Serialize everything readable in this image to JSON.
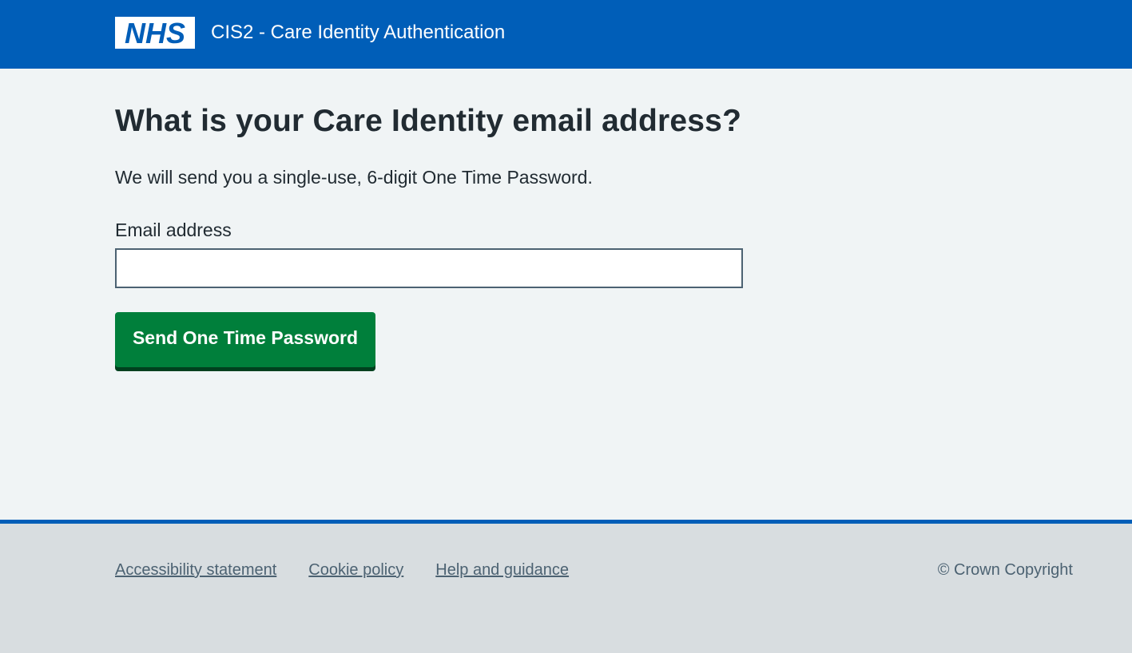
{
  "header": {
    "logo_text": "NHS",
    "service_name": "CIS2 - Care Identity Authentication"
  },
  "main": {
    "title": "What is your Care Identity email address?",
    "lead": "We will send you a single-use, 6-digit One Time Password.",
    "email_label": "Email address",
    "email_value": "",
    "email_placeholder": "",
    "submit_label": "Send One Time Password"
  },
  "footer": {
    "links": [
      {
        "label": "Accessibility statement"
      },
      {
        "label": "Cookie policy"
      },
      {
        "label": "Help and guidance"
      }
    ],
    "copyright": "© Crown Copyright"
  },
  "colors": {
    "header_blue": "#005eb8",
    "page_background": "#f0f4f5",
    "button_green": "#007f3b",
    "button_shadow": "#00401e",
    "footer_background": "#d8dde0",
    "footer_text": "#4c6272",
    "text": "#212b32"
  }
}
